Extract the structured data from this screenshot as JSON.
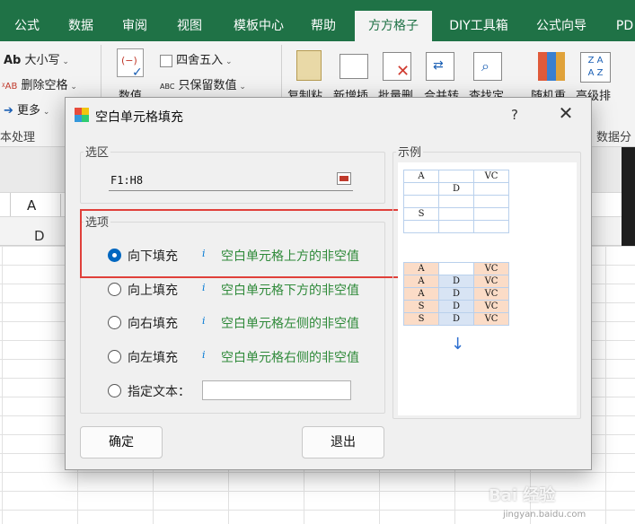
{
  "ribbon_tabs": [
    {
      "label": "公式",
      "active": false
    },
    {
      "label": "数据",
      "active": false
    },
    {
      "label": "审阅",
      "active": false
    },
    {
      "label": "视图",
      "active": false
    },
    {
      "label": "模板中心",
      "active": false
    },
    {
      "label": "帮助",
      "active": false
    },
    {
      "label": "方方格子",
      "active": true
    },
    {
      "label": "DIY工具箱",
      "active": false
    },
    {
      "label": "公式向导",
      "active": false
    },
    {
      "label": "PD",
      "active": false
    }
  ],
  "ribbon": {
    "case_prefix": "Ab",
    "case_label": "大小写",
    "remove_space_prefix": "ᵡAB",
    "remove_space_label": "删除空格",
    "more_label": "更多",
    "text_group_label": "本处理",
    "round_label": "四舍五入",
    "keep_value_prefix": "ABC",
    "keep_value_label": "只保留数值",
    "numeric_label": "数值",
    "copy_paste_label": "复制粘",
    "new_insert_label": "新增插",
    "batch_delete_label": "批量删",
    "merge_convert_label": "合并转",
    "find_locate_label": "查找定",
    "random_label": "随机重",
    "sort_label": "高级排",
    "sort_icon_text": "Z A\nA Z",
    "data_group_label": "数据分",
    "formula_cell": "A",
    "column_d": "D"
  },
  "dialog": {
    "title": "空白单元格填充",
    "help": "?",
    "close": "✕",
    "range_group_label": "选区",
    "range_value": "F1:H8",
    "options_group_label": "选项",
    "options": [
      {
        "label": "向下填充",
        "info": "i",
        "desc": "空白单元格上方的非空值",
        "selected": true
      },
      {
        "label": "向上填充",
        "info": "i",
        "desc": "空白单元格下方的非空值",
        "selected": false
      },
      {
        "label": "向右填充",
        "info": "i",
        "desc": "空白单元格左侧的非空值",
        "selected": false
      },
      {
        "label": "向左填充",
        "info": "i",
        "desc": "空白单元格右侧的非空值",
        "selected": false
      }
    ],
    "custom_text_label": "指定文本：",
    "custom_text_value": "",
    "example_label": "示例",
    "example_before": [
      [
        "A",
        "",
        "VC"
      ],
      [
        "",
        "D",
        ""
      ],
      [
        "",
        "",
        ""
      ],
      [
        "S",
        "",
        ""
      ],
      [
        "",
        "",
        ""
      ]
    ],
    "example_after": [
      [
        "A",
        "",
        "VC"
      ],
      [
        "A",
        "D",
        "VC"
      ],
      [
        "A",
        "D",
        "VC"
      ],
      [
        "S",
        "D",
        "VC"
      ],
      [
        "S",
        "D",
        "VC"
      ]
    ],
    "arrow": "↓",
    "ok_label": "确定",
    "exit_label": "退出"
  },
  "watermark": {
    "brand": "Bai 经验",
    "url": "jingyan.baidu.com"
  },
  "colors": {
    "ribbon_green": "#1f7246",
    "accent_blue": "#0067c0",
    "desc_green": "#2f8a3a",
    "highlight_red": "#e0403a"
  }
}
